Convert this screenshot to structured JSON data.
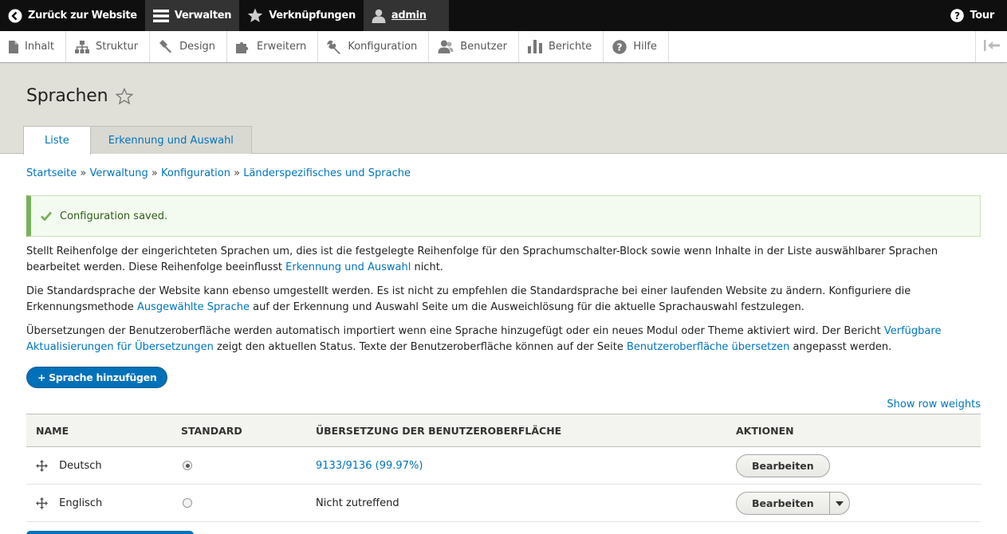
{
  "toolbar": {
    "back_label": "Zurück zur Website",
    "manage_label": "Verwalten",
    "shortcuts_label": "Verknüpfungen",
    "user_label": "admin",
    "tour_label": "Tour"
  },
  "tray": {
    "items": [
      {
        "label": "Inhalt",
        "icon": "file-icon"
      },
      {
        "label": "Struktur",
        "icon": "sitemap-icon"
      },
      {
        "label": "Design",
        "icon": "brush-icon"
      },
      {
        "label": "Erweitern",
        "icon": "puzzle-icon"
      },
      {
        "label": "Konfiguration",
        "icon": "wrench-icon"
      },
      {
        "label": "Benutzer",
        "icon": "users-icon"
      },
      {
        "label": "Berichte",
        "icon": "bar-chart-icon"
      },
      {
        "label": "Hilfe",
        "icon": "help-icon"
      }
    ]
  },
  "page": {
    "title": "Sprachen",
    "tabs": [
      "Liste",
      "Erkennung und Auswahl"
    ]
  },
  "breadcrumb": {
    "items": [
      "Startseite",
      "Verwaltung",
      "Konfiguration",
      "Länderspezifisches und Sprache"
    ],
    "separator": "»"
  },
  "message": {
    "text": "Configuration saved."
  },
  "description": {
    "p1_a": "Stellt Reihenfolge der eingerichteten Sprachen um, dies ist die festgelegte Reihenfolge für den Sprachumschalter-Block sowie wenn Inhalte in der Liste auswählbarer Sprachen bearbeitet werden. Diese Reihenfolge beeinflusst ",
    "p1_link": "Erkennung und Auswahl",
    "p1_b": " nicht.",
    "p2_a": "Die Standardsprache der Website kann ebenso umgestellt werden. Es ist nicht zu empfehlen die Standardsprache bei einer laufenden Website zu ändern. Konfiguriere die Erkennungsmethode ",
    "p2_link": "Ausgewählte Sprache",
    "p2_b": " auf der Erkennung und Auswahl Seite um die Ausweichlösung für die aktuelle Sprachauswahl festzulegen.",
    "p3_a": "Übersetzungen der Benutzeroberfläche werden automatisch importiert wenn eine Sprache hinzugefügt oder ein neues Modul oder Theme aktiviert wird. Der Bericht ",
    "p3_link1": "Verfügbare Aktualisierungen für Übersetzungen",
    "p3_b": " zeigt den aktuellen Status. Texte der Benutzeroberfläche können auf der Seite ",
    "p3_link2": "Benutzeroberfläche übersetzen",
    "p3_c": " angepasst werden."
  },
  "add_button": "+ Sprache hinzufügen",
  "row_weights": "Show row weights",
  "table": {
    "headers": [
      "Name",
      "Standard",
      "Übersetzung der Benutzeroberfläche",
      "Aktionen"
    ],
    "rows": [
      {
        "name": "Deutsch",
        "default": true,
        "translation": "9133/9136 (99.97%)",
        "translation_is_link": true,
        "action": "Bearbeiten"
      },
      {
        "name": "Englisch",
        "default": false,
        "translation": "Nicht zutreffend",
        "translation_is_link": false,
        "action": "Bearbeiten"
      }
    ]
  },
  "colors": {
    "toolbar_bg": "#0f0f0f",
    "link": "#0074bd",
    "primary_button": "#0071b8",
    "status_green": "#77b259"
  }
}
